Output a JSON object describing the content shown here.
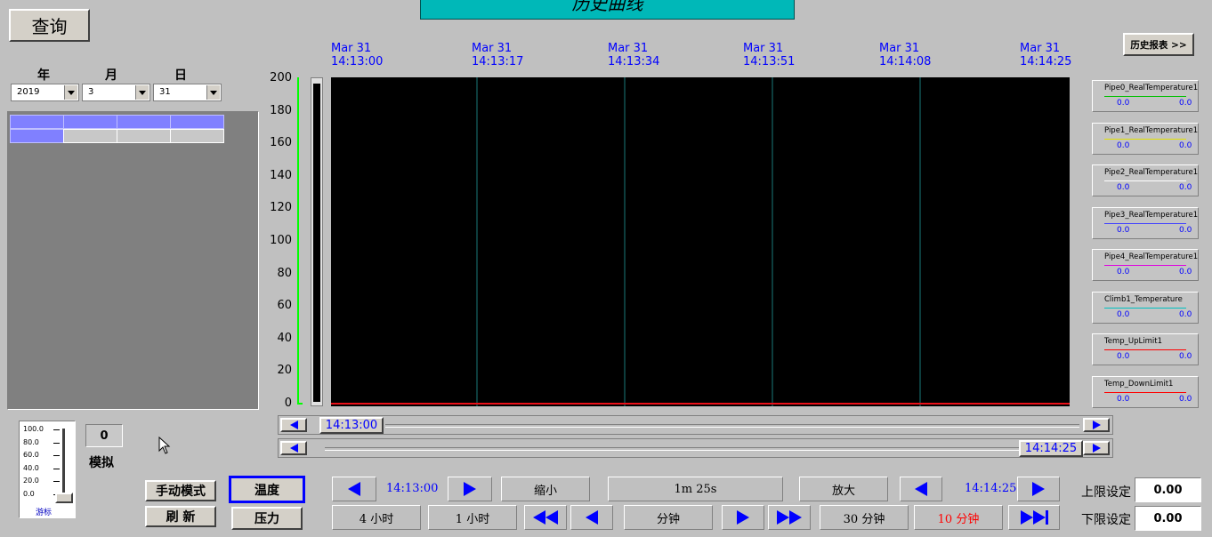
{
  "header": {
    "title": "历史曲线",
    "query_label": "查询",
    "report_button": "历史报表 >>"
  },
  "date_selector": {
    "year_label": "年",
    "month_label": "月",
    "day_label": "日",
    "year_value": "2019",
    "month_value": "3",
    "day_value": "31"
  },
  "chart": {
    "y_ticks": [
      "200",
      "180",
      "160",
      "140",
      "120",
      "100",
      "80",
      "60",
      "40",
      "20",
      "0"
    ],
    "x_labels": [
      {
        "date": "Mar 31",
        "time": "14:13:00"
      },
      {
        "date": "Mar 31",
        "time": "14:13:17"
      },
      {
        "date": "Mar 31",
        "time": "14:13:34"
      },
      {
        "date": "Mar 31",
        "time": "14:13:51"
      },
      {
        "date": "Mar 31",
        "time": "14:14:08"
      },
      {
        "date": "Mar 31",
        "time": "14:14:25"
      }
    ],
    "scroll_start_time": "14:13:00",
    "scroll_end_time": "14:14:25"
  },
  "chart_data": {
    "type": "line",
    "ylim": [
      0,
      200
    ],
    "x": [
      "14:13:00",
      "14:13:17",
      "14:13:34",
      "14:13:51",
      "14:14:08",
      "14:14:25"
    ],
    "series": [
      {
        "name": "Pipe0_RealTemperature1",
        "values": [
          0,
          0,
          0,
          0,
          0,
          0
        ]
      },
      {
        "name": "Pipe1_RealTemperature1",
        "values": [
          0,
          0,
          0,
          0,
          0,
          0
        ]
      },
      {
        "name": "Pipe2_RealTemperature1",
        "values": [
          0,
          0,
          0,
          0,
          0,
          0
        ]
      },
      {
        "name": "Pipe3_RealTemperature1",
        "values": [
          0,
          0,
          0,
          0,
          0,
          0
        ]
      },
      {
        "name": "Pipe4_RealTemperature1",
        "values": [
          0,
          0,
          0,
          0,
          0,
          0
        ]
      },
      {
        "name": "Climb1_Temperature",
        "values": [
          0,
          0,
          0,
          0,
          0,
          0
        ]
      },
      {
        "name": "Temp_UpLimit1",
        "values": [
          0,
          0,
          0,
          0,
          0,
          0
        ]
      },
      {
        "name": "Temp_DownLimit1",
        "values": [
          0,
          0,
          0,
          0,
          0,
          0
        ]
      }
    ],
    "grid": false
  },
  "legend": [
    {
      "name": "Pipe0_RealTemperature1",
      "color": "#00c000",
      "v1": "0.0",
      "v2": "0.0"
    },
    {
      "name": "Pipe1_RealTemperature1",
      "color": "#e0e000",
      "v1": "0.0",
      "v2": "0.0"
    },
    {
      "name": "Pipe2_RealTemperature1",
      "color": "#ffffff",
      "v1": "0.0",
      "v2": "0.0"
    },
    {
      "name": "Pipe3_RealTemperature1",
      "color": "#4040ff",
      "v1": "0.0",
      "v2": "0.0"
    },
    {
      "name": "Pipe4_RealTemperature1",
      "color": "#e000e0",
      "v1": "0.0",
      "v2": "0.0"
    },
    {
      "name": "Climb1_Temperature",
      "color": "#00c0c0",
      "v1": "0.0",
      "v2": "0.0"
    },
    {
      "name": "Temp_UpLimit1",
      "color": "#ff0000",
      "v1": "0.0",
      "v2": "0.0"
    },
    {
      "name": "Temp_DownLimit1",
      "color": "#ff0000",
      "v1": "0.0",
      "v2": "0.0"
    }
  ],
  "left_panel": {
    "slider_ticks": [
      "100.0",
      "80.0",
      "60.0",
      "40.0",
      "20.0",
      "0.0"
    ],
    "slider_label": "游标",
    "sim_value": "0",
    "sim_label": "模拟",
    "manual_mode": "手动模式",
    "refresh": "刷 新"
  },
  "mode_buttons": {
    "temperature": "温度",
    "pressure": "压力"
  },
  "nav": {
    "start_time": "14:13:00",
    "zoom_out": "缩小",
    "span": "1m 25s",
    "zoom_in": "放大",
    "end_time": "14:14:25",
    "four_hours": "4 小时",
    "one_hour": "1 小时",
    "minute": "分钟",
    "thirty_min": "30 分钟",
    "ten_min": "10 分钟"
  },
  "limits": {
    "upper_label": "上限设定",
    "upper_value": "0.00",
    "lower_label": "下限设定",
    "lower_value": "0.00"
  },
  "colors": {
    "title_bg": "#00b8b8",
    "plot_bg": "#000000",
    "axis_green": "#00ff00",
    "accent_blue": "#0000ff",
    "active_red": "#ff0000"
  }
}
